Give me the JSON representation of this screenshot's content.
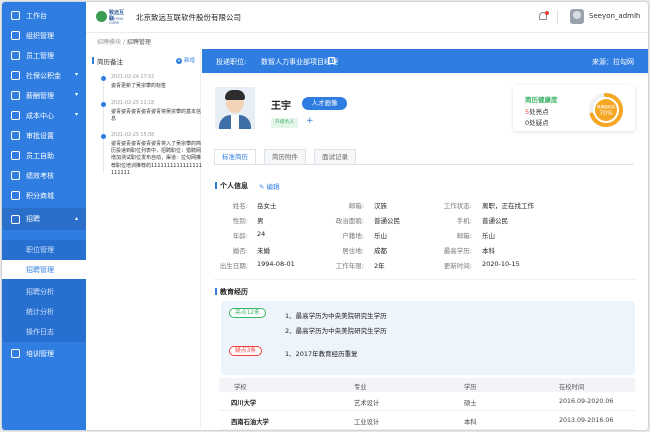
{
  "sidebar": {
    "items": [
      {
        "label": "工作台",
        "icon": "dashboard-icon"
      },
      {
        "label": "组织管理",
        "icon": "org-icon"
      },
      {
        "label": "员工管理",
        "icon": "employee-icon"
      },
      {
        "label": "社保公积金",
        "icon": "insurance-icon"
      },
      {
        "label": "薪酬管理",
        "icon": "salary-icon"
      },
      {
        "label": "成本中心",
        "icon": "cost-icon"
      },
      {
        "label": "审批设置",
        "icon": "approval-icon"
      },
      {
        "label": "员工自助",
        "icon": "self-service-icon"
      },
      {
        "label": "绩效考核",
        "icon": "performance-icon"
      },
      {
        "label": "积分商城",
        "icon": "mall-icon"
      },
      {
        "label": "招聘",
        "icon": "recruit-icon"
      },
      {
        "label": "职位管理"
      },
      {
        "label": "招聘管理"
      },
      {
        "label": "招聘分析"
      },
      {
        "label": "统计分析"
      },
      {
        "label": "操作日志"
      },
      {
        "label": "培训管理",
        "icon": "training-icon"
      }
    ]
  },
  "header": {
    "logo_text": "致远互联",
    "logo_sub": "SEEYON CORP.",
    "company": "北京致远互联软件股份有限公司",
    "user": "Seeyon_admin"
  },
  "breadcrumb": {
    "parent": "招聘模块",
    "sep": "/",
    "current": "招聘管理"
  },
  "notes": {
    "title": "简历备注",
    "add": "新增",
    "items": [
      {
        "time": "2021-02-24 17:52",
        "text": "姿青更新了吴宗攀的标签"
      },
      {
        "time": "2021-02-25 11:18",
        "text": "姿青姿青姿青姿青姿青将吴宗攀的基本信息"
      },
      {
        "time": "2021-02-25 15:08",
        "text": "姿青姿青姿青姿青姿青将入了吴宗攀的简历投递到职位列表中，招聘职位：猎聘网增加测试职位发布自动，渠道：拉勾网推荐职位培训推荐的1111111111111111111111"
      }
    ]
  },
  "main": {
    "position_label": "投递职位:",
    "position_value": "数智人力事业部项目经理",
    "source": "来源：拉勾网",
    "name": "王宇",
    "talent_tag": "人才画像",
    "green_tag": "升级负人",
    "add_tag": "+",
    "health": {
      "title": "简历健康度",
      "highlights_num": "5",
      "highlights_text": "处亮点",
      "doubts": "0处疑点",
      "gauge_text": "健康度较高",
      "gauge_value": "70%",
      "percent": 70
    },
    "tabs": [
      "标准简历",
      "简历附件",
      "面试记录"
    ],
    "personal_title": "个人信息",
    "edit": "编辑",
    "info": [
      {
        "label": "姓名:",
        "value": "岳女士"
      },
      {
        "label": "邮箱:",
        "value": "汉族"
      },
      {
        "label": "工作状态:",
        "value": "离职，正在找工作"
      },
      {
        "label": "性别:",
        "value": "男"
      },
      {
        "label": "政治面貌:",
        "value": "普通公民"
      },
      {
        "label": "手机:",
        "value": "普通公民"
      },
      {
        "label": "年龄:",
        "value": "24"
      },
      {
        "label": "户籍地:",
        "value": "乐山"
      },
      {
        "label": "邮箱:",
        "value": "乐山"
      },
      {
        "label": "婚否:",
        "value": "未婚"
      },
      {
        "label": "居住地:",
        "value": "成都"
      },
      {
        "label": "最高学历:",
        "value": "本科"
      },
      {
        "label": "出生日期:",
        "value": "1994-08-01"
      },
      {
        "label": "工作年限:",
        "value": "2年"
      },
      {
        "label": "更新时间:",
        "value": "2020-10-15"
      }
    ],
    "edu_title": "教育经历",
    "highlights_pill": "亮点12条",
    "highlight_lines": [
      "1、最高学历为中央美院研究生学历",
      "2、最高学历为中央美院研究生学历"
    ],
    "doubts_pill": "疑点3条",
    "doubt_lines": [
      "1、2017年教育经历重复"
    ],
    "table": {
      "headers": [
        "学校",
        "专业",
        "学历",
        "在校时间"
      ],
      "rows": [
        [
          "四川大学",
          "艺术设计",
          "硕士",
          "2016.09-2020.06"
        ],
        [
          "西南石油大学",
          "工业设计",
          "本科",
          "2013.09-2016.06"
        ]
      ]
    }
  },
  "colors": {
    "primary": "#2f7de1",
    "green": "#3bb266",
    "red": "#f0403c",
    "gauge": "#f5a623"
  }
}
